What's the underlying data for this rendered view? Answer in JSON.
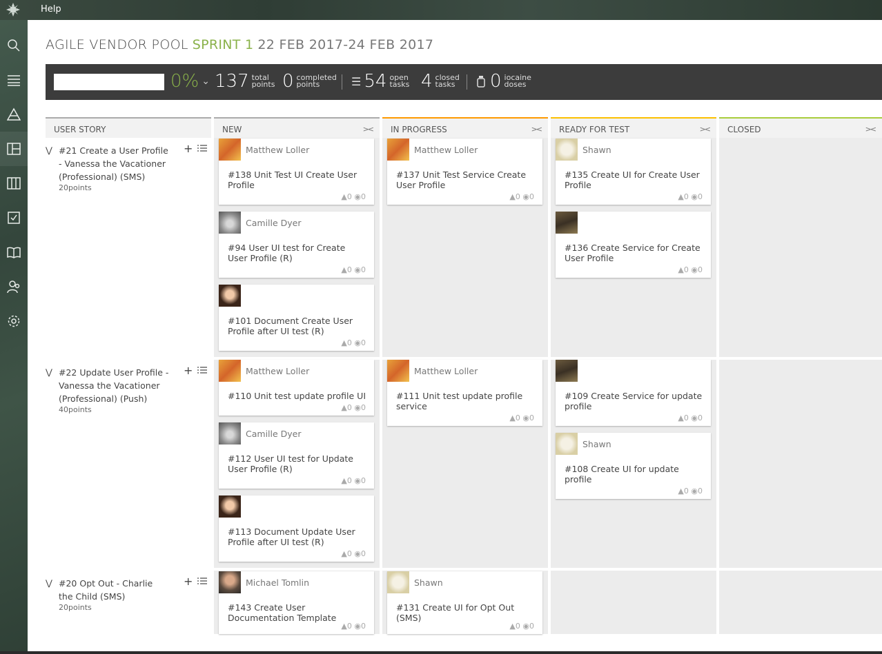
{
  "topbar": {
    "help_label": "Help"
  },
  "sidebar": {
    "items": [
      {
        "icon": "search-icon"
      },
      {
        "icon": "backlog-icon"
      },
      {
        "icon": "epics-icon"
      },
      {
        "icon": "taskboard-icon"
      },
      {
        "icon": "kanban-icon"
      },
      {
        "icon": "issues-icon"
      },
      {
        "icon": "wiki-icon"
      },
      {
        "icon": "team-icon"
      },
      {
        "icon": "settings-icon"
      }
    ]
  },
  "header": {
    "project": "AGILE VENDOR POOL",
    "sprint": "SPRINT 1",
    "dates": "22 FEB 2017-24 FEB 2017"
  },
  "summary": {
    "progress": "0%",
    "total_points": "137",
    "total_label_1": "total",
    "total_label_2": "points",
    "completed_points": "0",
    "completed_label_1": "completed",
    "completed_label_2": "points",
    "open_tasks": "54",
    "open_label_1": "open",
    "open_label_2": "tasks",
    "closed_tasks": "4",
    "closed_label_1": "closed",
    "closed_label_2": "tasks",
    "iocaine": "0",
    "iocaine_label_1": "iocaine",
    "iocaine_label_2": "doses"
  },
  "columns": {
    "user_story": "USER STORY",
    "new": "NEW",
    "in_progress": "IN PROGRESS",
    "ready_for_test": "READY FOR TEST",
    "closed": "CLOSED",
    "collapse_glyph": "><"
  },
  "colors": {
    "new": "#aaaaaa",
    "in_progress": "#ff9900",
    "ready_for_test": "#fcc000",
    "closed": "#a8cd3b",
    "accent": "#8ab24a"
  },
  "stories": [
    {
      "title": "#21 Create a User Profile - Vanessa the Vacationer (Professional) (SMS)",
      "points": "20points"
    },
    {
      "title": "#22 Update User Profile - Vanessa the Vacationer (Professional) (Push)",
      "points": "40points"
    },
    {
      "title": "#20 Opt Out - Charlie the Child (SMS)",
      "points": "20points"
    }
  ],
  "cards": {
    "c138": {
      "owner": "Matthew Loller",
      "title": "#138 Unit Test UI Create User Profile",
      "votes": "0",
      "watchers": "0"
    },
    "c94": {
      "owner": "Camille Dyer",
      "title": "#94 User UI test for Create User Profile (R)",
      "votes": "0",
      "watchers": "0"
    },
    "c101": {
      "owner": "",
      "title": "#101 Document Create User Profile after UI test (R)",
      "votes": "0",
      "watchers": "0"
    },
    "c137": {
      "owner": "Matthew Loller",
      "title": "#137 Unit Test Service Create User Profile",
      "votes": "0",
      "watchers": "0"
    },
    "c135": {
      "owner": "Shawn",
      "title": "#135 Create UI for Create User Profile",
      "votes": "0",
      "watchers": "0"
    },
    "c136": {
      "owner": "",
      "title": "#136 Create Service for Create User Profile",
      "votes": "0",
      "watchers": "0"
    },
    "c110": {
      "owner": "Matthew Loller",
      "title": "#110 Unit test update profile UI",
      "votes": "0",
      "watchers": "0"
    },
    "c112": {
      "owner": "Camille Dyer",
      "title": "#112 User UI test for Update User Profile (R)",
      "votes": "0",
      "watchers": "0"
    },
    "c113": {
      "owner": "",
      "title": "#113 Document Update User Profile after UI test (R)",
      "votes": "0",
      "watchers": "0"
    },
    "c111": {
      "owner": "Matthew Loller",
      "title": "#111 Unit test update profile service",
      "votes": "0",
      "watchers": "0"
    },
    "c109": {
      "owner": "",
      "title": "#109 Create Service for update profile",
      "votes": "0",
      "watchers": "0"
    },
    "c108": {
      "owner": "Shawn",
      "title": "#108 Create UI for update profile",
      "votes": "0",
      "watchers": "0"
    },
    "c143": {
      "owner": "Michael Tomlin",
      "title": "#143 Create User Documentation Template",
      "votes": "0",
      "watchers": "0"
    },
    "c131": {
      "owner": "Shawn",
      "title": "#131 Create UI for Opt Out (SMS)",
      "votes": "0",
      "watchers": "0"
    }
  }
}
